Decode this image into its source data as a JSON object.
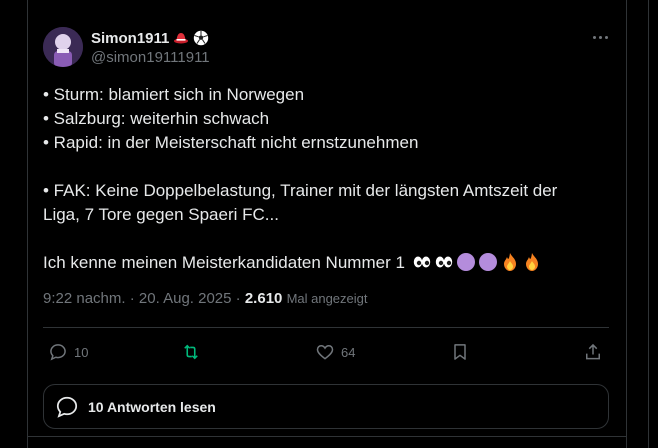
{
  "author": {
    "display_name": "Simon1911",
    "handle": "@simon19111911",
    "badges": [
      "red-hat-emoji",
      "soccer-ball-emoji"
    ]
  },
  "tweet": {
    "lines": [
      "• Sturm: blamiert sich in Norwegen",
      "• Salzburg: weiterhin schwach",
      "• Rapid: in der Meisterschaft nicht ernstzunehmen",
      "",
      "• FAK: Keine Doppelbelastung, Trainer mit der längsten Amtszeit der",
      "Liga, 7 Tore gegen Spaeri FC...",
      "",
      "Ich kenne meinen Meisterkandidaten Nummer 1"
    ],
    "trailing_emojis": [
      "eyes",
      "eyes",
      "purple-circle",
      "purple-circle",
      "fire",
      "fire"
    ]
  },
  "meta": {
    "time": "9:22 nachm.",
    "separator": "·",
    "date": "20. Aug. 2025",
    "views": "2.610",
    "views_label": "Mal angezeigt"
  },
  "actions": {
    "replies": "10",
    "retweets": "",
    "likes": "64"
  },
  "read_replies_label": "10 Antworten lesen",
  "colors": {
    "background": "#000000",
    "text": "#e7e9ea",
    "muted": "#71767b",
    "border": "#2f3336",
    "retweet_accent": "#00ba7c",
    "purple": "#b48cdc",
    "fire": "#f58220"
  }
}
